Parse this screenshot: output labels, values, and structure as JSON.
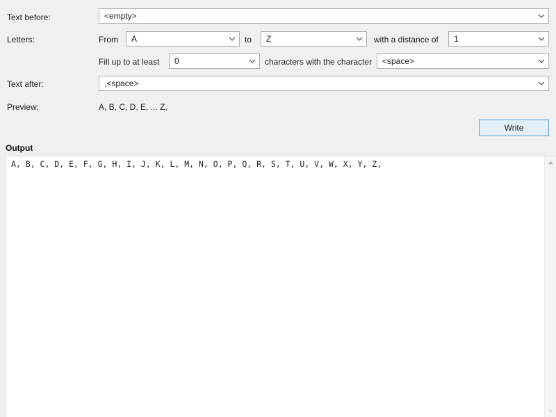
{
  "colors": {
    "window_bg": "#f0f0f0",
    "field_bg": "#ffffff",
    "field_border": "#acacac",
    "button_focus_bg": "#e3eff9",
    "button_focus_border": "#5a9fd4",
    "text": "#1d1d1d",
    "scrollbar_bg": "#f4f4f4"
  },
  "form": {
    "text_before": {
      "label": "Text before:",
      "value": "<empty>",
      "arrow_icon": "chevron-down-icon"
    },
    "letters": {
      "label": "Letters:",
      "from_label": "From",
      "from_value": "A",
      "to_label": "to",
      "to_value": "Z",
      "distance_label": "with a distance of",
      "distance_value": "1"
    },
    "fill": {
      "prefix_label": "Fill up to at least",
      "count_value": "0",
      "middle_label": "characters with the character",
      "char_value": "<space>"
    },
    "text_after": {
      "label": "Text after:",
      "value": ",<space>"
    },
    "preview": {
      "label": "Preview:",
      "value": "A, B, C, D, E, ... Z,"
    },
    "write_button": {
      "label": "Write"
    }
  },
  "output": {
    "group_label": "Output",
    "text": "A, B, C, D, E, F, G, H, I, J, K, L, M, N, O, P, Q, R, S, T, U, V, W, X, Y, Z,",
    "scrollbar": {
      "up_icon": "scroll-up-arrow-icon",
      "down_icon": "scroll-down-arrow-icon"
    }
  }
}
